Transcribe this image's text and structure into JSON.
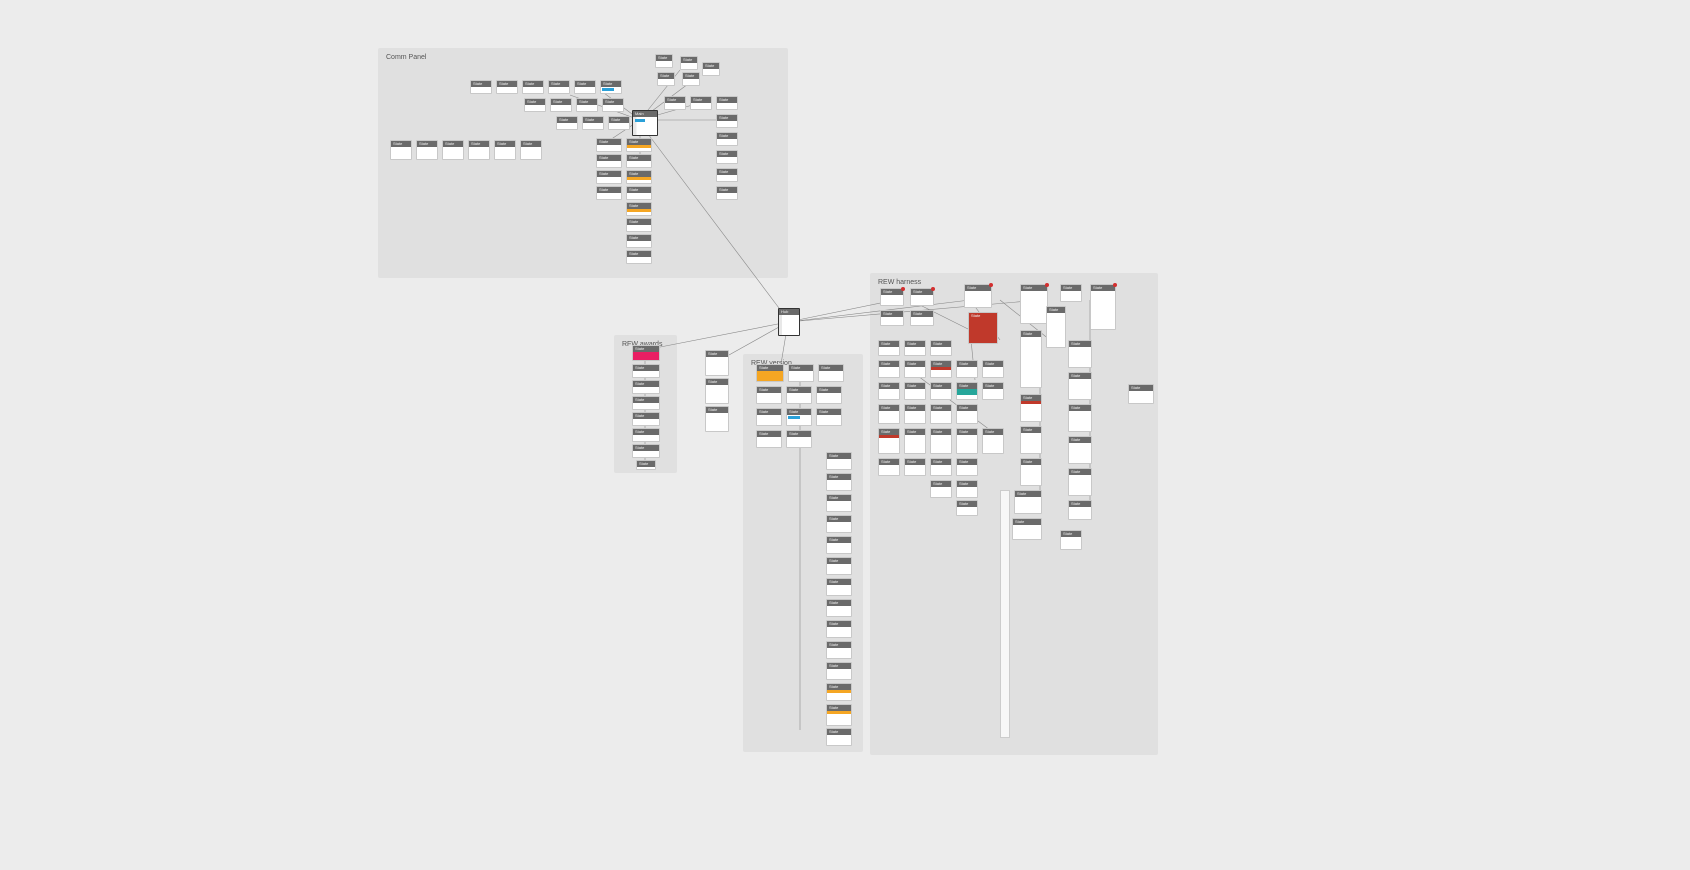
{
  "groups": {
    "comm": {
      "label": "Comm Panel"
    },
    "rewards": {
      "label": "RFW awards"
    },
    "version": {
      "label": "REW version"
    },
    "harness": {
      "label": "REW harness"
    }
  },
  "hub_main": {
    "title": "Main"
  },
  "hub_mid": {
    "title": "Hub"
  },
  "generic_title": "State",
  "colors": {
    "orange": "#f5a623",
    "pink": "#e91e63",
    "red": "#c0392b",
    "blue": "#2aa0d8",
    "teal": "#26a69a"
  }
}
